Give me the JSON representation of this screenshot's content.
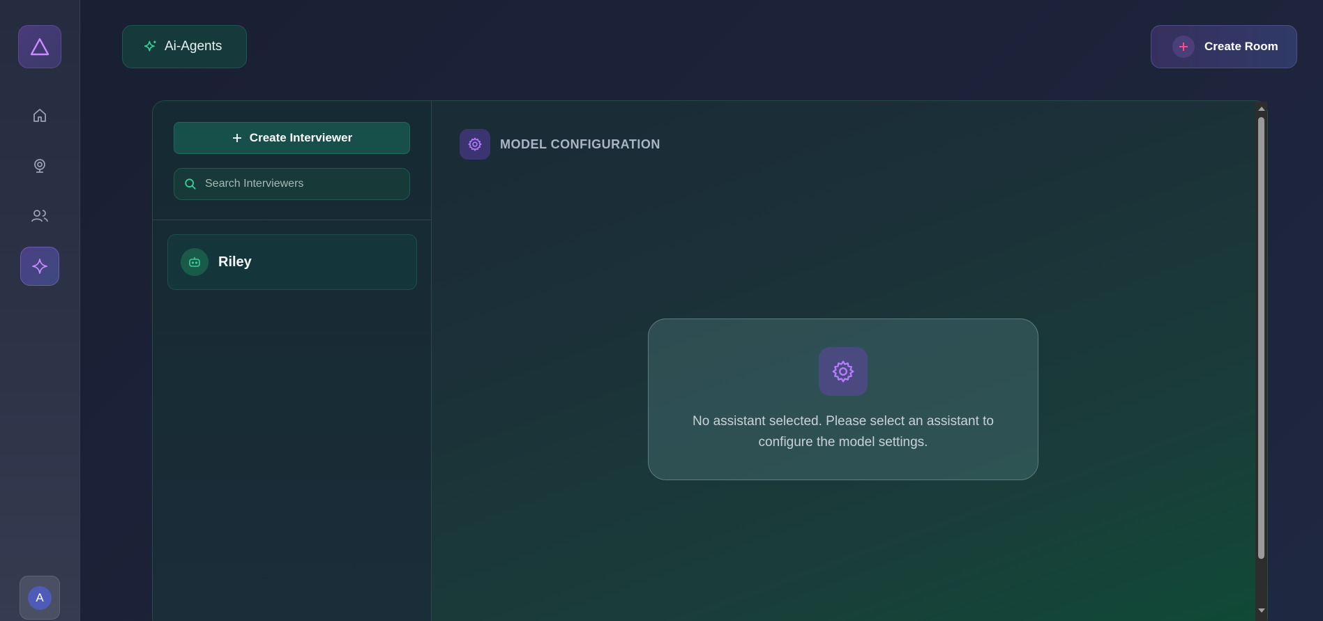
{
  "sidebar": {
    "logo_icon": "triangle-logo-icon",
    "nav": [
      {
        "name": "home",
        "icon": "home-icon"
      },
      {
        "name": "webcam",
        "icon": "webcam-icon"
      },
      {
        "name": "users",
        "icon": "users-icon"
      },
      {
        "name": "ai-agents",
        "icon": "sparkle-icon",
        "active": true
      }
    ],
    "avatar_letter": "A"
  },
  "header": {
    "agents_label": "Ai-Agents",
    "create_room_label": "Create Room"
  },
  "list": {
    "create_button_label": "Create Interviewer",
    "search_placeholder": "Search Interviewers",
    "items": [
      {
        "name": "Riley",
        "icon": "bot-icon"
      }
    ]
  },
  "config": {
    "title": "MODEL CONFIGURATION",
    "empty_message": "No assistant selected. Please select an assistant to configure the model settings."
  },
  "colors": {
    "accent_purple": "#b57bff",
    "accent_green": "#34d399",
    "panel_bg": "#1a3038"
  }
}
